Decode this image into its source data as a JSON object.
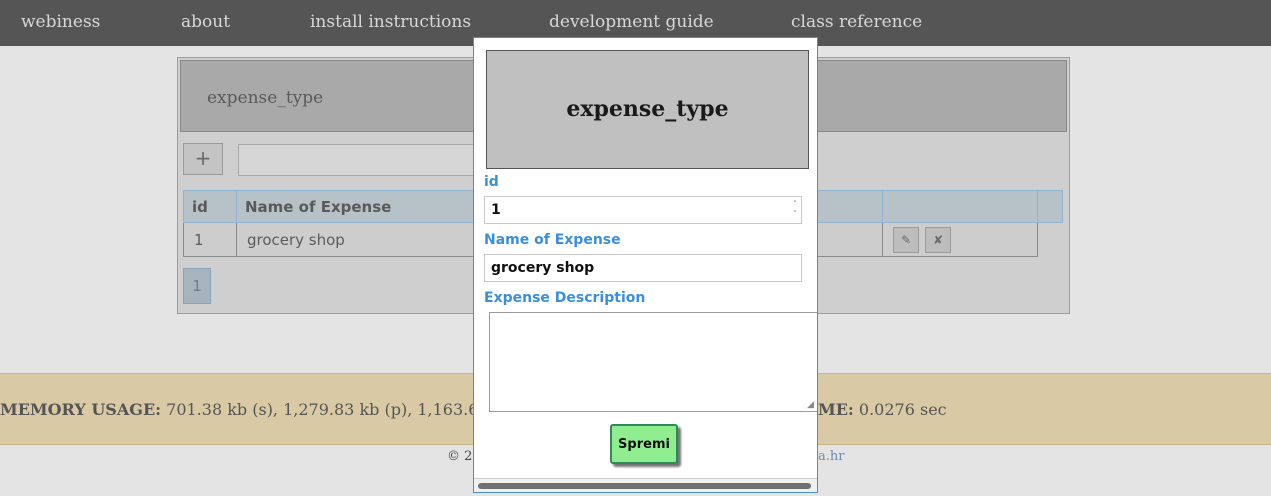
{
  "nav": {
    "items": [
      "webiness",
      "about",
      "install instructions",
      "development guide",
      "class reference"
    ]
  },
  "panel": {
    "title": "expense_type",
    "add_label": "+",
    "columns": [
      "id",
      "Name of Expense"
    ],
    "rows": [
      {
        "id": "1",
        "name": "grocery shop"
      }
    ],
    "edit_icon": "✎",
    "delete_icon": "✘",
    "page": "1"
  },
  "memory": {
    "label": "MEMORY USAGE:",
    "value": "701.38 kb (s), 1,279.83 kb (p), 1,163.6",
    "time_label": "ME:",
    "time_value": "0.0276 sec"
  },
  "footer": {
    "text": "© 2",
    "link": "a.hr"
  },
  "modal": {
    "title": "expense_type",
    "fields": {
      "id_label": "id",
      "id_value": "1",
      "name_label": "Name of Expense",
      "name_value": "grocery shop",
      "desc_label": "Expense Description",
      "desc_value": ""
    },
    "submit_label": "Spremi"
  },
  "colors": {
    "nav_bg": "#555555",
    "accent_blue": "#3b8fd9",
    "submit_green": "#90ee90",
    "memory_bar": "#d9c9a4"
  }
}
